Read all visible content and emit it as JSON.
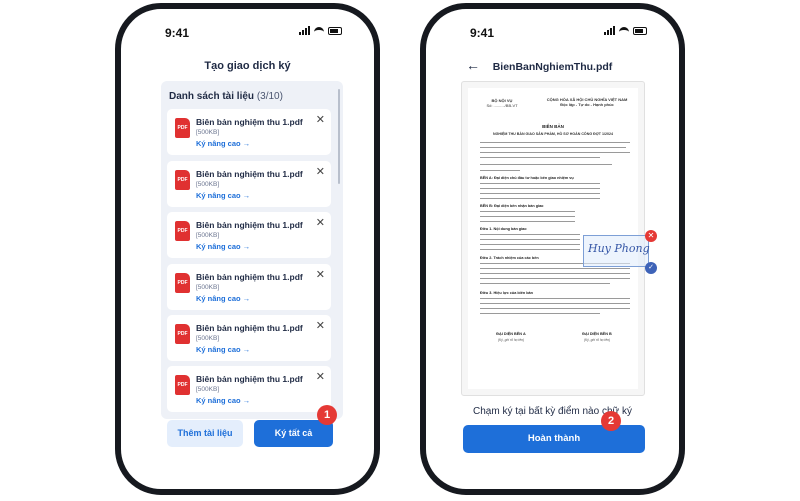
{
  "left_screen": {
    "status_time": "9:41",
    "title": "Tạo giao dịch ký",
    "list_title": "Danh sách tài liệu",
    "list_count": "(3/10)",
    "files": [
      {
        "name": "Biên bản nghiệm thu 1.pdf",
        "size": "[500KB]",
        "link": "Ký nâng cao →",
        "icon": "PDF"
      },
      {
        "name": "Biên bản nghiệm thu 1.pdf",
        "size": "[500KB]",
        "link": "Ký nâng cao →",
        "icon": "PDF"
      },
      {
        "name": "Biên bản nghiệm thu 1.pdf",
        "size": "[500KB]",
        "link": "Ký nâng cao →",
        "icon": "PDF"
      },
      {
        "name": "Biên bản nghiệm thu 1.pdf",
        "size": "[500KB]",
        "link": "Ký nâng cao →",
        "icon": "PDF"
      },
      {
        "name": "Biên bản nghiệm thu 1.pdf",
        "size": "[500KB]",
        "link": "Ký nâng cao →",
        "icon": "PDF"
      },
      {
        "name": "Biên bản nghiệm thu 1.pdf",
        "size": "[500KB]",
        "link": "Ký nâng cao →",
        "icon": "PDF"
      }
    ],
    "close_glyph": "✕",
    "add_button": "Thêm tài liệu",
    "sign_all_button": "Ký tất cả",
    "step_badge": "1"
  },
  "right_screen": {
    "status_time": "9:41",
    "back_glyph": "←",
    "title": "BienBanNghiemThu.pdf",
    "document": {
      "org": "BỘ NỘI VỤ",
      "org_no": "Số: ........../BB-VT",
      "nation": "CỘNG HÒA XÃ HỘI CHỦ NGHĨA VIỆT NAM",
      "motto": "Độc lập - Tự do - Hạnh phúc",
      "doc_title": "BIÊN BẢN",
      "doc_subject": "NGHIỆM THU BÀN GIAO SẢN PHẨM, HỒ SƠ HOÀN CÔNG ĐỢT 1/2024",
      "section_a": "BÊN A: Đại diện chủ đầu tư hoặc bên giao nhiệm vụ",
      "section_b": "BÊN B: Đại diện bên nhận bàn giao",
      "article_1": "Điều 1. Nội dung bàn giao",
      "article_2": "Điều 2. Trách nhiệm của các bên",
      "article_3": "Điều 3. Hiệu lực của biên bản",
      "rep_a": "ĐẠI DIỆN BÊN A",
      "rep_a_sub": "(Ký, ghi rõ họ tên)",
      "rep_b": "ĐẠI DIỆN BÊN B",
      "rep_b_sub": "(Ký, ghi rõ họ tên)"
    },
    "signature_text": "Huy Phong",
    "signature_remove": "✕",
    "signature_confirm": "✓",
    "hint": "Chạm ký tại bất kỳ điểm nào chữ ký",
    "done_button": "Hoàn thành",
    "step_badge": "2"
  },
  "colors": {
    "primary": "#1e6fd9",
    "secondary_bg": "#e4eefc",
    "badge": "#e53935",
    "pdf_icon": "#e03131",
    "panel_bg": "#eef1f7"
  },
  "icons": [
    "pdf-icon",
    "close-icon",
    "back-arrow-icon",
    "signal-icon",
    "wifi-icon",
    "battery-icon"
  ]
}
